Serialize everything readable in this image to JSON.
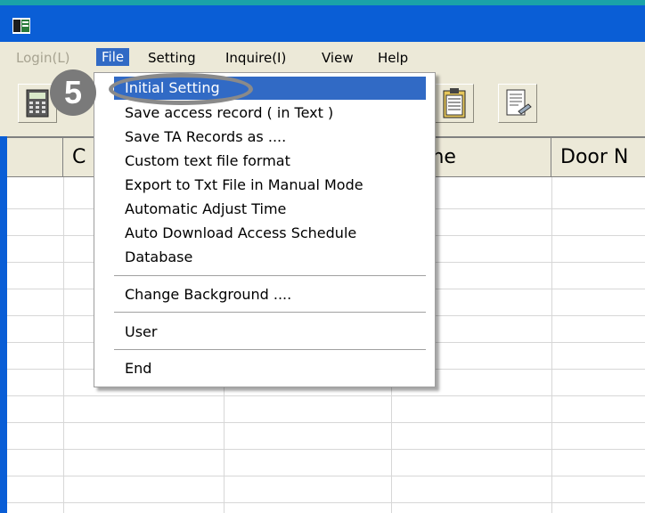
{
  "menubar": {
    "items": [
      {
        "label": "Login(L)"
      },
      {
        "label": "File"
      },
      {
        "label": "Setting"
      },
      {
        "label": "Inquire(I)"
      },
      {
        "label": "View"
      },
      {
        "label": "Help"
      }
    ]
  },
  "grid": {
    "headers": [
      "C",
      "me",
      "Door N"
    ]
  },
  "file_menu": {
    "items": [
      "Initial Setting",
      "Save access record ( in Text )",
      "Save TA Records as ....",
      "Custom text file format",
      "Export to Txt File in Manual Mode",
      "Automatic Adjust Time",
      "Auto Download Access Schedule",
      "Database",
      "Change Background ....",
      "User",
      "End"
    ]
  },
  "callout": {
    "step": "5"
  },
  "colors": {
    "title_bar": "#0a5ed6",
    "highlight": "#316ac5"
  },
  "icons": [
    "app-icon",
    "calculator-icon",
    "clipboard-icon",
    "document-edit-icon"
  ]
}
